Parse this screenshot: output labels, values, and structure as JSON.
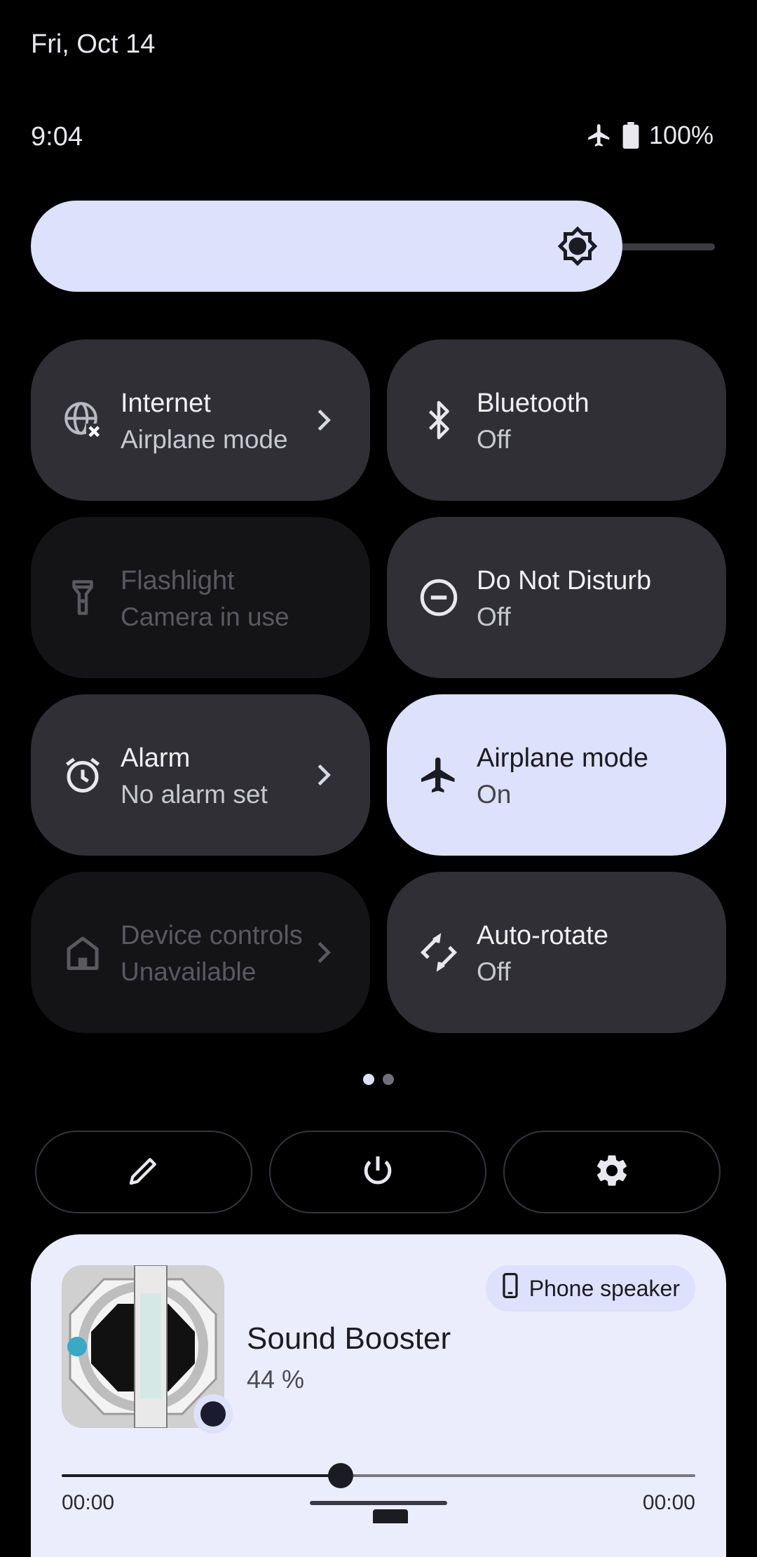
{
  "header": {
    "date": "Fri, Oct 14",
    "time": "9:04",
    "battery_percent": "100%",
    "airplane_icon": "airplane-icon",
    "battery_icon": "battery-full-icon"
  },
  "brightness": {
    "level": 0.9,
    "icon": "brightness-icon"
  },
  "tiles": [
    {
      "title": "Internet",
      "subtitle": "Airplane mode",
      "icon": "globe-off-icon",
      "state": "off",
      "has_chevron": true
    },
    {
      "title": "Bluetooth",
      "subtitle": "Off",
      "icon": "bluetooth-icon",
      "state": "off",
      "has_chevron": false
    },
    {
      "title": "Flashlight",
      "subtitle": "Camera in use",
      "icon": "flashlight-icon",
      "state": "unavailable",
      "has_chevron": false
    },
    {
      "title": "Do Not Disturb",
      "subtitle": "Off",
      "icon": "do-not-disturb-icon",
      "state": "off",
      "has_chevron": false
    },
    {
      "title": "Alarm",
      "subtitle": "No alarm set",
      "icon": "alarm-icon",
      "state": "off",
      "has_chevron": true
    },
    {
      "title": "Airplane mode",
      "subtitle": "On",
      "icon": "airplane-icon",
      "state": "on",
      "has_chevron": false
    },
    {
      "title": "Device controls",
      "subtitle": "Unavailable",
      "icon": "home-icon",
      "state": "unavailable",
      "has_chevron": true
    },
    {
      "title": "Auto-rotate",
      "subtitle": "Off",
      "icon": "rotate-icon",
      "state": "off",
      "has_chevron": false
    }
  ],
  "pager": {
    "pages": 2,
    "current": 1
  },
  "actions": [
    {
      "icon": "edit-icon"
    },
    {
      "icon": "power-icon"
    },
    {
      "icon": "settings-gear-icon"
    }
  ],
  "media": {
    "output_label": "Phone speaker",
    "output_icon": "phone-icon",
    "title": "Sound Booster",
    "subtitle": "44 %",
    "elapsed": "00:00",
    "duration": "00:00",
    "progress": 0.44
  },
  "colors": {
    "accent": "#dde1fb",
    "tile_bg": "#2f2f35",
    "tile_dim_bg": "#141416",
    "background": "#000000"
  }
}
